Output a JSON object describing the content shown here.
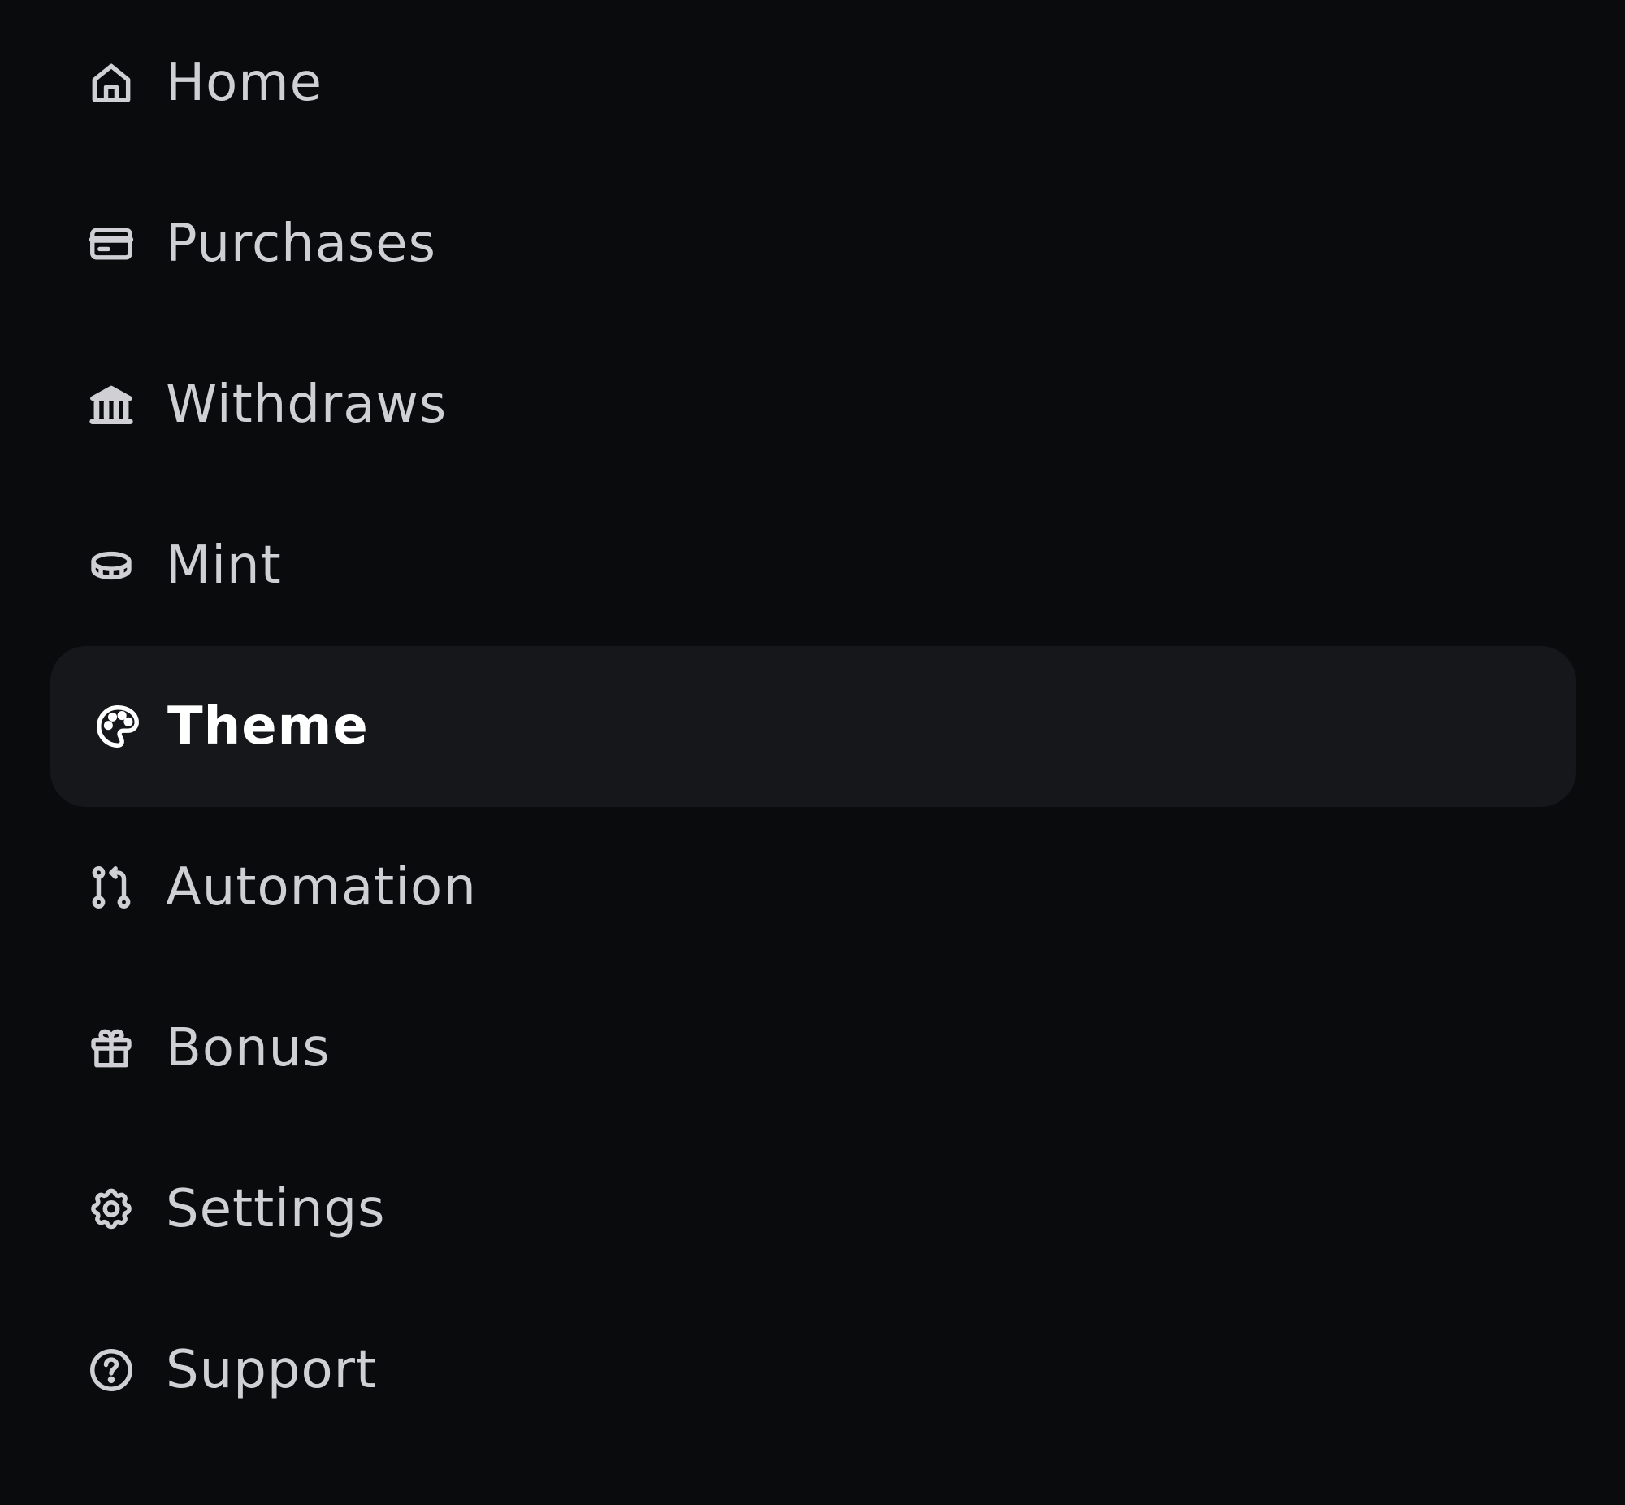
{
  "sidebar": {
    "items": [
      {
        "label": "Home",
        "icon": "home-icon"
      },
      {
        "label": "Purchases",
        "icon": "credit-card-icon"
      },
      {
        "label": "Withdraws",
        "icon": "bank-icon"
      },
      {
        "label": "Mint",
        "icon": "coin-icon"
      },
      {
        "label": "Theme",
        "icon": "palette-icon",
        "active": true
      },
      {
        "label": "Automation",
        "icon": "git-pull-request-icon"
      },
      {
        "label": "Bonus",
        "icon": "gift-icon"
      },
      {
        "label": "Settings",
        "icon": "gear-icon"
      },
      {
        "label": "Support",
        "icon": "help-circle-icon"
      }
    ]
  },
  "colors": {
    "background": "#0a0b0d",
    "active_background": "#16171b",
    "text": "#cfcfd4",
    "active_text": "#ffffff"
  }
}
